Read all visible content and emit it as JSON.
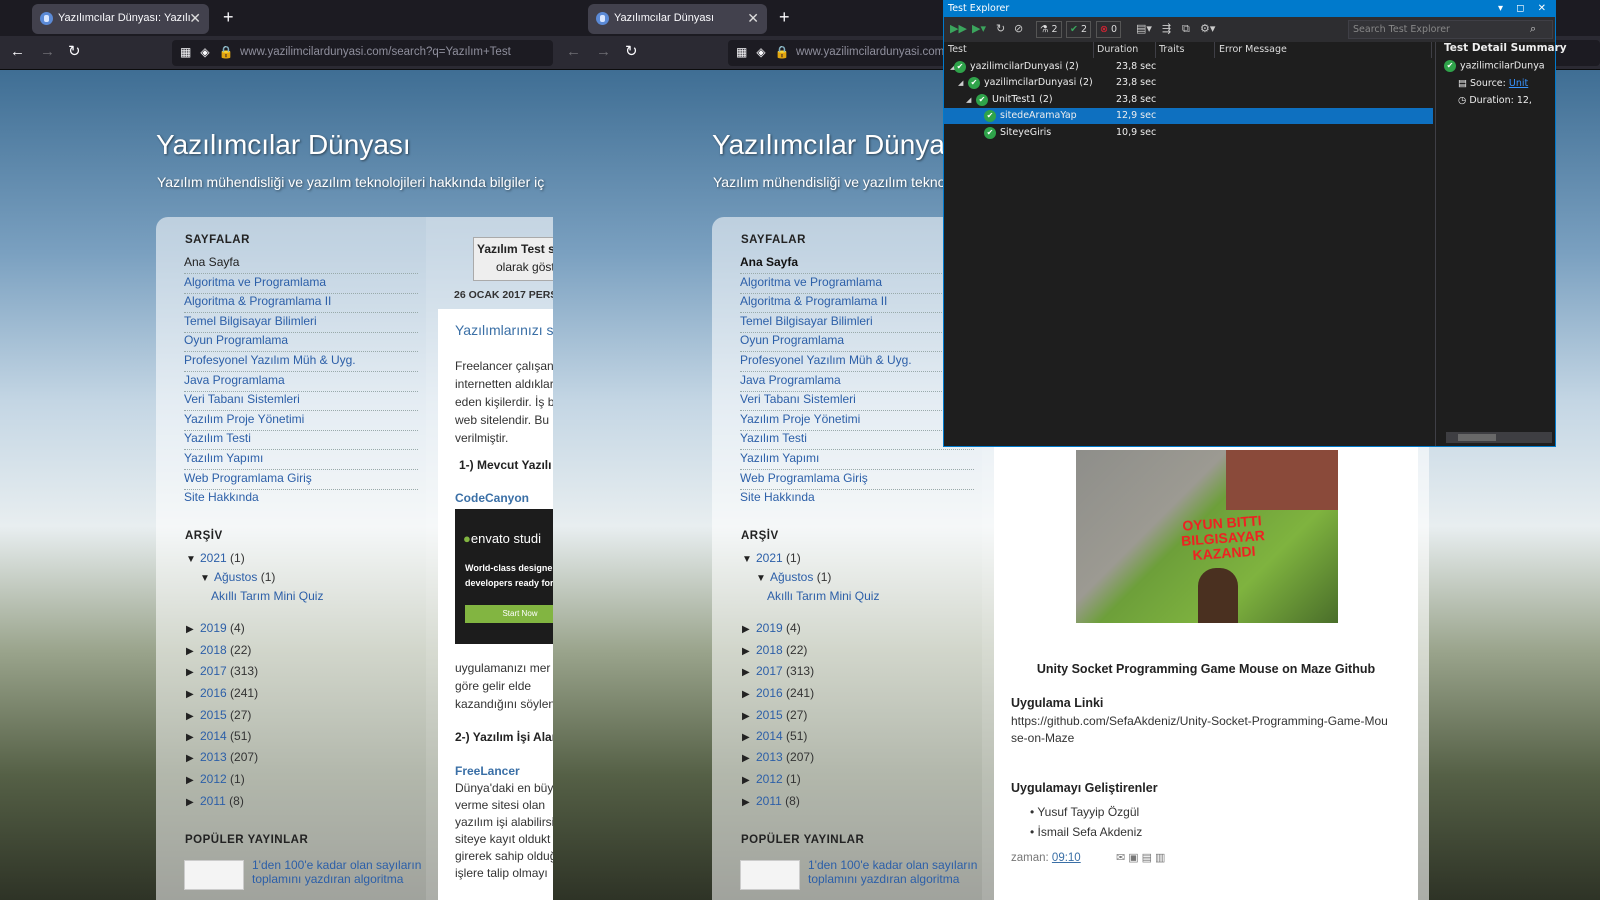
{
  "left": {
    "tab_title": "Yazılımcılar Dünyası: Yazılım Tes",
    "url": "www.yazilimcilardunyasi.com/search?q=Yazılım+Test",
    "search_box_l1": "Yazılım Test s",
    "search_box_l2": "olarak göst",
    "date": "26 OCAK 2017 PERŞ",
    "post_title": "Yazılımlarınızı s",
    "p1": [
      "Freelancer çalışan",
      "internetten aldıkları",
      "eden kişilerdir. İş b",
      "web sitelendir. Bu",
      "verilmiştir."
    ],
    "h1": "1-) Mevcut Yazılı",
    "link1": "CodeCanyon",
    "ad_brand": "envato studi",
    "ad_text1": "World-class designe",
    "ad_text2": "developers ready for",
    "ad_btn": "Start Now",
    "p2": [
      "uygulamanızı mer",
      "göre gelir elde",
      "kazandığını söylen"
    ],
    "h2": "2-) Yazılım İşi Alan",
    "link2": "FreeLancer",
    "p3": [
      "Dünya'daki en büy",
      "verme sitesi olan",
      "yazılım işi alabilirsi",
      "siteye kayıt oldukt",
      "girerek sahip olduğ",
      "işlere talip olmayı"
    ]
  },
  "right": {
    "tab_title": "Yazılımcılar Dünyası",
    "url": "www.yazilimcilardunyasi.com",
    "game_text": "OYUN BITTI BILGISAYAR KAZANDI",
    "post_heading": "Unity Socket Programming Game Mouse on Maze Github",
    "app_link_label": "Uygulama Linki",
    "app_link": "https://github.com/SefaAkdeniz/Unity-Socket-Programming-Game-Mouse-on-Maze",
    "dev_label": "Uygulamayı Geliştirenler",
    "devs": [
      "Yusuf Tayyip Özgül",
      "İsmail Sefa Akdeniz"
    ],
    "time_label": "zaman:",
    "time": "09:10"
  },
  "blog": {
    "title": "Yazılımcılar Dünyası",
    "desc": "Yazılım mühendisliği ve yazılım teknolojileri hakkında bilgiler iç",
    "pages_label": "SAYFALAR",
    "archive_label": "ARŞİV",
    "popular_label": "POPÜLER YAYINLAR",
    "pages": [
      "Ana Sayfa",
      "Algoritma ve Programlama",
      "Algoritma & Programlama II",
      "Temel Bilgisayar Bilimleri",
      "Oyun Programlama",
      "Profesyonel Yazılım Müh & Uyg.",
      "Java Programlama",
      "Veri Tabanı Sistemleri",
      "Yazılım Proje Yönetimi",
      "Yazılım Testi",
      "Yazılım Yapımı",
      "Web Programlama Giriş",
      "Site Hakkında"
    ],
    "archive_2021": "2021",
    "archive_2021_count": "(1)",
    "archive_month": "Ağustos",
    "archive_month_count": "(1)",
    "archive_post": "Akıllı Tarım Mini Quiz",
    "years": [
      [
        "2019",
        "(4)"
      ],
      [
        "2018",
        "(22)"
      ],
      [
        "2017",
        "(313)"
      ],
      [
        "2016",
        "(241)"
      ],
      [
        "2015",
        "(27)"
      ],
      [
        "2014",
        "(51)"
      ],
      [
        "2013",
        "(207)"
      ],
      [
        "2012",
        "(1)"
      ],
      [
        "2011",
        "(8)"
      ]
    ],
    "popular_post": "1'den 100'e kadar olan sayıların toplamını yazdıran algoritma"
  },
  "test_explorer": {
    "title": "Test Explorer",
    "count_total": "2",
    "count_passed": "2",
    "count_failed": "0",
    "search_placeholder": "Search Test Explorer",
    "columns": [
      "Test",
      "Duration",
      "Traits",
      "Error Message"
    ],
    "rows": [
      {
        "name": "yazilimcilarDunyasi (2)",
        "dur": "23,8 sec"
      },
      {
        "name": "yazilimcilarDunyasi (2)",
        "dur": "23,8 sec"
      },
      {
        "name": "UnitTest1 (2)",
        "dur": "23,8 sec"
      },
      {
        "name": "sitedeAramaYap",
        "dur": "12,9 sec"
      },
      {
        "name": "SiteyeGiris",
        "dur": "10,9 sec"
      }
    ],
    "detail_title": "Test Detail Summary",
    "detail_name": "yazilimcilarDunya",
    "source_label": "Source:",
    "source_val": "Unit",
    "duration_label": "Duration:",
    "duration_val": "12,"
  }
}
